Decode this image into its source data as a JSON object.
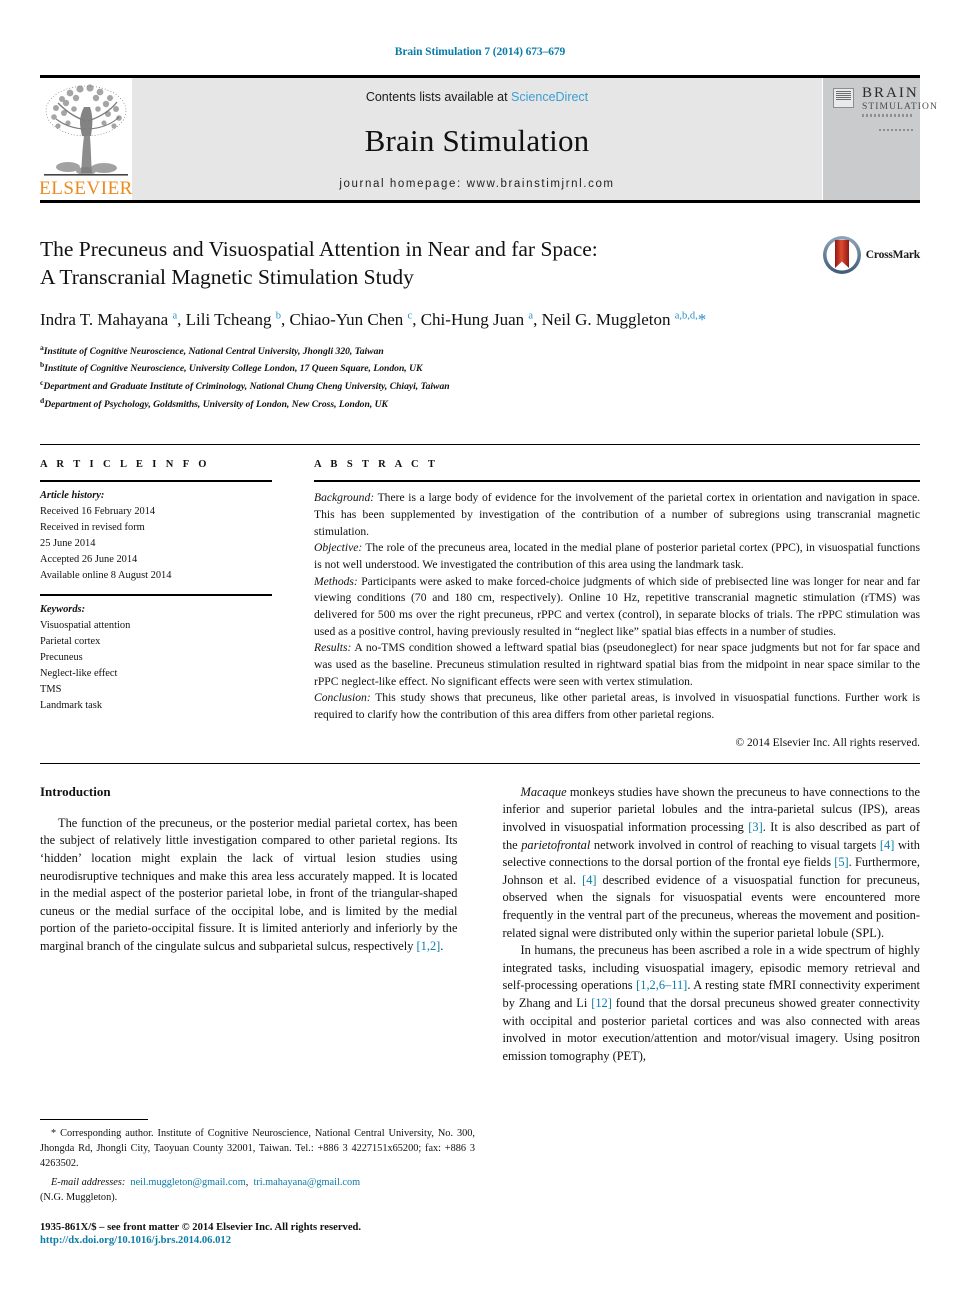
{
  "running_head": "Brain Stimulation 7 (2014) 673–679",
  "masthead": {
    "contents_prefix": "Contents lists available at ",
    "sciencedirect": "ScienceDirect",
    "journal_name": "Brain Stimulation",
    "homepage": "journal homepage: www.brainstimjrnl.com",
    "publisher_logo_text": "ELSEVIER",
    "cover_title_line1": "BRAIN",
    "cover_title_line2": "STIMULATION"
  },
  "article": {
    "title_line1": "The Precuneus and Visuospatial Attention in Near and far Space:",
    "title_line2": "A Transcranial Magnetic Stimulation Study",
    "crossmark_label": "CrossMark",
    "authors_html": "Indra T. Mahayana <sup>a</sup>, Lili Tcheang <sup>b</sup>, Chiao-Yun Chen <sup>c</sup>, Chi-Hung Juan <sup>a</sup>, Neil G. Muggleton <sup>a,b,d,</sup><span class=\"star\">*</span>",
    "affiliations": [
      {
        "marker": "a",
        "text": "Institute of Cognitive Neuroscience, National Central University, Jhongli 320, Taiwan"
      },
      {
        "marker": "b",
        "text": "Institute of Cognitive Neuroscience, University College London, 17 Queen Square, London, UK"
      },
      {
        "marker": "c",
        "text": "Department and Graduate Institute of Criminology, National Chung Cheng University, Chiayi, Taiwan"
      },
      {
        "marker": "d",
        "text": "Department of Psychology, Goldsmiths, University of London, New Cross, London, UK"
      }
    ]
  },
  "article_info": {
    "heading": "A R T I C L E   I N F O",
    "history_label": "Article history:",
    "history_lines": [
      "Received 16 February 2014",
      "Received in revised form",
      "25 June 2014",
      "Accepted 26 June 2014",
      "Available online 8 August 2014"
    ],
    "keywords_label": "Keywords:",
    "keywords": [
      "Visuospatial attention",
      "Parietal cortex",
      "Precuneus",
      "Neglect-like effect",
      "TMS",
      "Landmark task"
    ]
  },
  "abstract": {
    "heading": "A B S T R A C T",
    "sections": [
      {
        "label": "Background:",
        "text": " There is a large body of evidence for the involvement of the parietal cortex in orientation and navigation in space. This has been supplemented by investigation of the contribution of a number of subregions using transcranial magnetic stimulation."
      },
      {
        "label": "Objective:",
        "text": " The role of the precuneus area, located in the medial plane of posterior parietal cortex (PPC), in visuospatial functions is not well understood. We investigated the contribution of this area using the landmark task."
      },
      {
        "label": "Methods:",
        "text": " Participants were asked to make forced-choice judgments of which side of prebisected line was longer for near and far viewing conditions (70 and 180 cm, respectively). Online 10 Hz, repetitive transcranial magnetic stimulation (rTMS) was delivered for 500 ms over the right precuneus, rPPC and vertex (control), in separate blocks of trials. The rPPC stimulation was used as a positive control, having previously resulted in “neglect like” spatial bias effects in a number of studies."
      },
      {
        "label": "Results:",
        "text": " A no-TMS condition showed a leftward spatial bias (pseudoneglect) for near space judgments but not for far space and was used as the baseline. Precuneus stimulation resulted in rightward spatial bias from the midpoint in near space similar to the rPPC neglect-like effect. No significant effects were seen with vertex stimulation."
      },
      {
        "label": "Conclusion:",
        "text": " This study shows that precuneus, like other parietal areas, is involved in visuospatial functions. Further work is required to clarify how the contribution of this area differs from other parietal regions."
      }
    ],
    "copyright": "© 2014 Elsevier Inc. All rights reserved."
  },
  "body": {
    "section_title": "Introduction",
    "left_paragraph": "The function of the precuneus, or the posterior medial parietal cortex, has been the subject of relatively little investigation compared to other parietal regions. Its ‘hidden’ location might explain the lack of virtual lesion studies using neurodisruptive techniques and make this area less accurately mapped. It is located in the medial aspect of the posterior parietal lobe, in front of the triangular-shaped cuneus or the medial surface of the occipital lobe, and is limited by the medial portion of the parieto-occipital fissure. It is limited anteriorly and inferiorly by the marginal branch of the cingulate sulcus and subparietal sulcus, respectively ",
    "left_paragraph_ref": "[1,2]",
    "left_paragraph_end": ".",
    "right_paragraph_1_html": "<span class=\"ital\">Macaque</span> monkeys studies have shown the precuneus to have connections to the inferior and superior parietal lobules and the intra-parietal sulcus (IPS), areas involved in visuospatial information processing <span class=\"ref\">[3]</span>. It is also described as part of the <span class=\"ital\">parietofrontal</span> network involved in control of reaching to visual targets <span class=\"ref\">[4]</span> with selective connections to the dorsal portion of the frontal eye fields <span class=\"ref\">[5]</span>. Furthermore, Johnson et al. <span class=\"ref\">[4]</span> described evidence of a visuospatial function for precuneus, observed when the signals for visuospatial events were encountered more frequently in the ventral part of the precuneus, whereas the movement and position-related signal were distributed only within the superior parietal lobule (SPL).",
    "right_paragraph_2_html": "In humans, the precuneus has been ascribed a role in a wide spectrum of highly integrated tasks, including visuospatial imagery, episodic memory retrieval and self-processing operations <span class=\"ref\">[1,2,6–11]</span>. A resting state fMRI connectivity experiment by Zhang and Li <span class=\"ref\">[12]</span> found that the dorsal precuneus showed greater connectivity with occipital and posterior parietal cortices and was also connected with areas involved in motor execution/attention and motor/visual imagery. Using positron emission tomography (PET),"
  },
  "footnotes": {
    "corresponding_html": "* Corresponding author. Institute of Cognitive Neuroscience, National Central University, No. 300, Jhongda Rd, Jhongli City, Taoyuan County 32001, Taiwan. Tel.: +886 3 4227151x65200; fax: +886 3 4263502.",
    "email_label": "E-mail addresses:",
    "email_1": "neil.muggleton@gmail.com",
    "email_2": "tri.mahayana@gmail.com",
    "email_attrib": "(N.G. Muggleton).",
    "front_matter": "1935-861X/$ – see front matter © 2014 Elsevier Inc. All rights reserved.",
    "doi": "http://dx.doi.org/10.1016/j.brs.2014.06.012"
  },
  "colors": {
    "link_blue": "#0b7ca8",
    "sciencedirect_blue": "#3a9ed4",
    "elsevier_orange": "#ec8a1e",
    "masthead_gray": "#e6e6e6"
  }
}
